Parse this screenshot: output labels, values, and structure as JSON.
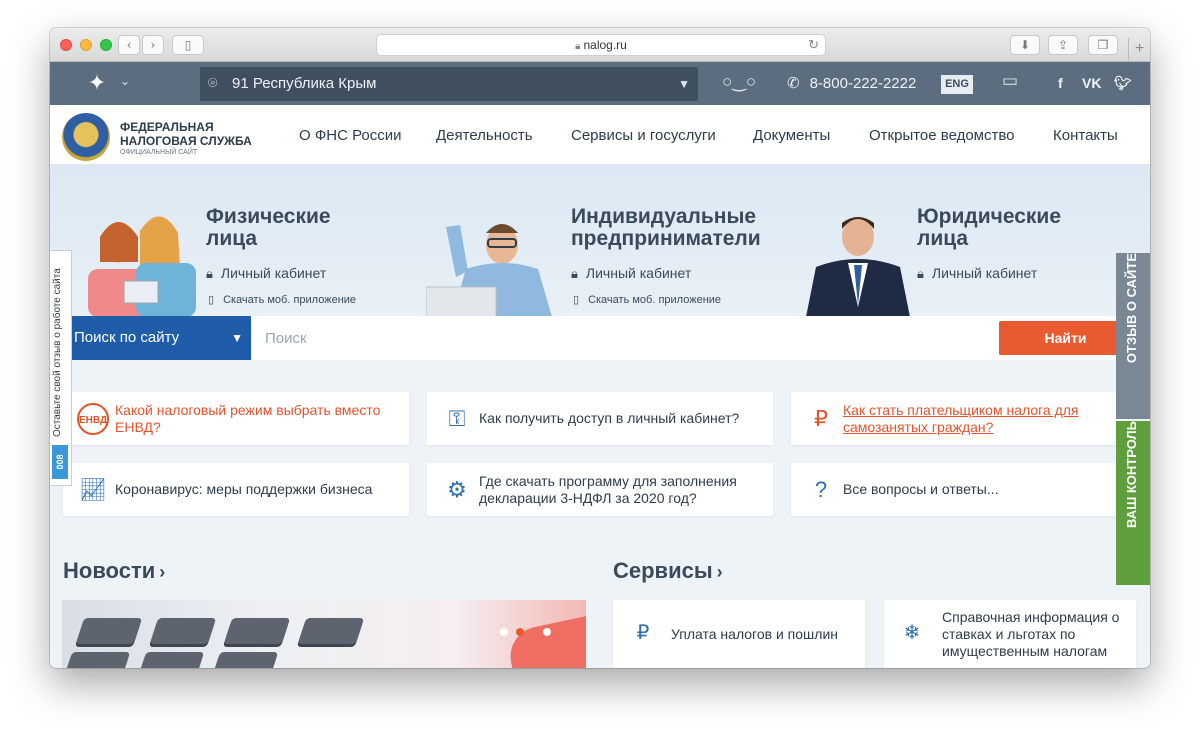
{
  "browser": {
    "url": "nalog.ru",
    "colors": {
      "close": "#fc605b",
      "minimize": "#fdbc40",
      "zoom": "#34c84a"
    }
  },
  "topbar": {
    "region": "91 Республика Крым",
    "phone": "8-800-222-2222",
    "lang": "ENG",
    "social": [
      "f",
      "VK",
      "twitter"
    ]
  },
  "logo": {
    "line1": "ФЕДЕРАЛЬНАЯ",
    "line2": "НАЛОГОВАЯ СЛУЖБА",
    "sub": "ОФИЦИАЛЬНЫЙ САЙТ"
  },
  "nav": [
    "О ФНС России",
    "Деятельность",
    "Сервисы и госуслуги",
    "Документы",
    "Открытое ведомство",
    "Контакты"
  ],
  "hero": {
    "categories": [
      {
        "title1": "Физические",
        "title2": "лица",
        "cabinet": "Личный кабинет",
        "app": "Скачать моб. приложение"
      },
      {
        "title1": "Индивидуальные",
        "title2": "предприниматели",
        "cabinet": "Личный кабинет",
        "app": "Скачать моб. приложение"
      },
      {
        "title1": "Юридические",
        "title2": "лица",
        "cabinet": "Личный кабинет"
      }
    ]
  },
  "search": {
    "scope": "Поиск по сайту",
    "placeholder": "Поиск",
    "button": "Найти",
    "accent": "#ea5a30",
    "scope_color": "#1f5da8"
  },
  "quick_links": [
    {
      "icon": "envd-icon",
      "text": "Какой налоговый режим выбрать вместо ЕНВД?"
    },
    {
      "icon": "key-lk-icon",
      "text": "Как получить доступ в личный кабинет?"
    },
    {
      "icon": "self-employed-icon",
      "text": "Как стать плательщиком налога для самозанятых граждан?"
    },
    {
      "icon": "chart-up-icon",
      "text": "Коронавирус: меры поддержки бизнеса"
    },
    {
      "icon": "gear-stack-icon",
      "text": "Где скачать программу для заполнения декларации 3-НДФЛ за 2020 год?"
    },
    {
      "icon": "question-people-icon",
      "text": "Все вопросы и ответы..."
    }
  ],
  "side_tabs": {
    "feedback": "Оставьте свой отзыв о работе сайта",
    "counter": "008",
    "right_top": "ОТЗЫВ О САЙТЕ",
    "right_bottom": "ВАШ КОНТРОЛЬ"
  },
  "news": {
    "title": "Новости"
  },
  "services": {
    "title": "Сервисы",
    "items": [
      {
        "icon": "ruble-phone-icon",
        "text": "Уплата налогов и пошлин"
      },
      {
        "icon": "snowflake-info-icon",
        "text": "Справочная информация о ставках и льготах по имущественным налогам"
      }
    ]
  }
}
